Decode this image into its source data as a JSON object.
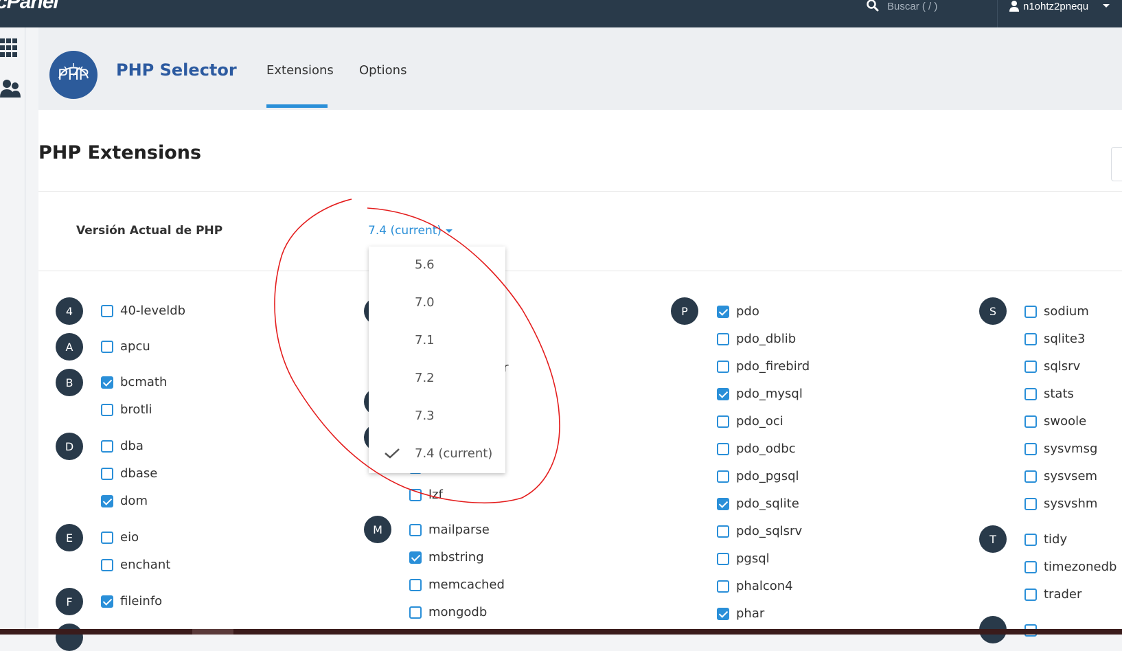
{
  "topbar": {
    "logo": "cPanel",
    "search_placeholder": "Buscar ( / )",
    "username": "n1ohtz2pnequ"
  },
  "app": {
    "logo_text": "PHP",
    "title": "PHP Selector",
    "tabs": [
      {
        "label": "Extensions",
        "active": true
      },
      {
        "label": "Options",
        "active": false
      }
    ]
  },
  "page": {
    "title": "PHP Extensions",
    "version_label": "Versión Actual de PHP",
    "version_value": "7.4 (current)"
  },
  "dropdown": {
    "options": [
      "5.6",
      "7.0",
      "7.1",
      "7.2",
      "7.3",
      "7.4 (current)"
    ],
    "selected": "7.4 (current)"
  },
  "extensions": {
    "col1": [
      {
        "letter": "4",
        "items": [
          {
            "name": "40-leveldb",
            "checked": false
          }
        ]
      },
      {
        "letter": "A",
        "items": [
          {
            "name": "apcu",
            "checked": false
          }
        ]
      },
      {
        "letter": "B",
        "items": [
          {
            "name": "bcmath",
            "checked": true
          },
          {
            "name": "brotli",
            "checked": false
          }
        ]
      },
      {
        "letter": "D",
        "items": [
          {
            "name": "dba",
            "checked": false
          },
          {
            "name": "dbase",
            "checked": false
          },
          {
            "name": "dom",
            "checked": true
          }
        ]
      },
      {
        "letter": "E",
        "items": [
          {
            "name": "eio",
            "checked": false
          },
          {
            "name": "enchant",
            "checked": false
          }
        ]
      },
      {
        "letter": "F",
        "items": [
          {
            "name": "fileinfo",
            "checked": true
          }
        ]
      }
    ],
    "col2": {
      "partial_text": "er",
      "lzf": {
        "name": "lzf",
        "checked": false
      },
      "m_letter": "M",
      "m_items": [
        {
          "name": "mailparse",
          "checked": false
        },
        {
          "name": "mbstring",
          "checked": true
        },
        {
          "name": "memcached",
          "checked": false
        },
        {
          "name": "mongodb",
          "checked": false
        }
      ]
    },
    "col3": {
      "letter": "P",
      "items": [
        {
          "name": "pdo",
          "checked": true
        },
        {
          "name": "pdo_dblib",
          "checked": false
        },
        {
          "name": "pdo_firebird",
          "checked": false
        },
        {
          "name": "pdo_mysql",
          "checked": true
        },
        {
          "name": "pdo_oci",
          "checked": false
        },
        {
          "name": "pdo_odbc",
          "checked": false
        },
        {
          "name": "pdo_pgsql",
          "checked": false
        },
        {
          "name": "pdo_sqlite",
          "checked": true
        },
        {
          "name": "pdo_sqlsrv",
          "checked": false
        },
        {
          "name": "pgsql",
          "checked": false
        },
        {
          "name": "phalcon4",
          "checked": false
        },
        {
          "name": "phar",
          "checked": true
        }
      ]
    },
    "col4": [
      {
        "letter": "S",
        "items": [
          {
            "name": "sodium",
            "checked": false
          },
          {
            "name": "sqlite3",
            "checked": false
          },
          {
            "name": "sqlsrv",
            "checked": false
          },
          {
            "name": "stats",
            "checked": false
          },
          {
            "name": "swoole",
            "checked": false
          },
          {
            "name": "sysvmsg",
            "checked": false
          },
          {
            "name": "sysvsem",
            "checked": false
          },
          {
            "name": "sysvshm",
            "checked": false
          }
        ]
      },
      {
        "letter": "T",
        "items": [
          {
            "name": "tidy",
            "checked": false
          },
          {
            "name": "timezonedb",
            "checked": false
          },
          {
            "name": "trader",
            "checked": false
          }
        ]
      }
    ]
  },
  "colors": {
    "topbar": "#293a4a",
    "accent": "#2a8fd8",
    "title_blue": "#2c5aa0",
    "annotation": "#e41e1e"
  }
}
